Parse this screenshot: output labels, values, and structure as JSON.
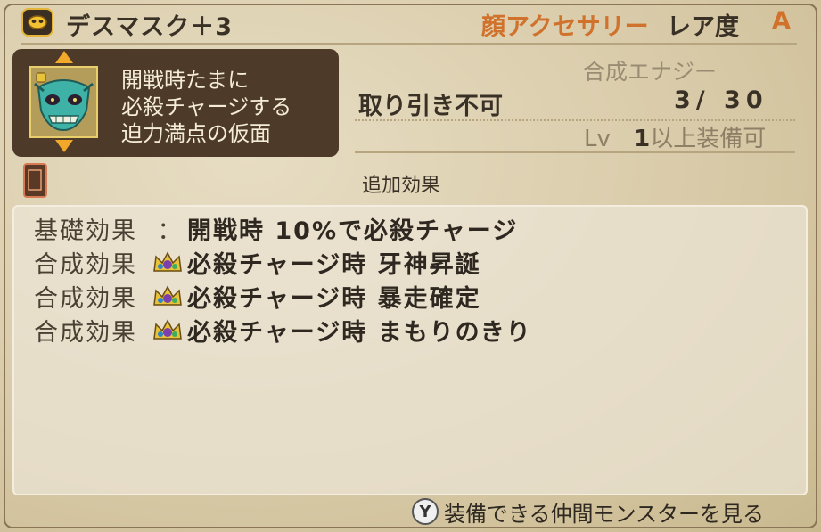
{
  "header": {
    "item_name": "デスマスク＋3",
    "category": "顔アクセサリー",
    "rarity_label": "レア度",
    "rarity": "A",
    "icon": "accessory-category-icon"
  },
  "item": {
    "icon": "death-mask-icon",
    "description": [
      "開戦時たまに",
      "必殺チャージする",
      "迫力満点の仮面"
    ]
  },
  "stats": {
    "trade": "取り引き不可",
    "energy_label": "合成エナジー",
    "energy_value": "3/ 30",
    "level_prefix": "Lv",
    "level_value": "1",
    "level_suffix": "以上装備可"
  },
  "effects": {
    "title": "追加効果",
    "rows": [
      {
        "label": "基礎効果",
        "prefix": "：",
        "text": "開戦時 10%で必殺チャージ"
      },
      {
        "label": "合成効果",
        "prefix": "crown-icon",
        "text": "必殺チャージ時 牙神昇誕"
      },
      {
        "label": "合成効果",
        "prefix": "crown-icon",
        "text": "必殺チャージ時 暴走確定"
      },
      {
        "label": "合成効果",
        "prefix": "crown-icon",
        "text": "必殺チャージ時 まもりのきり"
      }
    ]
  },
  "footer": {
    "button": "Y",
    "text": "装備できる仲間モンスターを見る"
  }
}
